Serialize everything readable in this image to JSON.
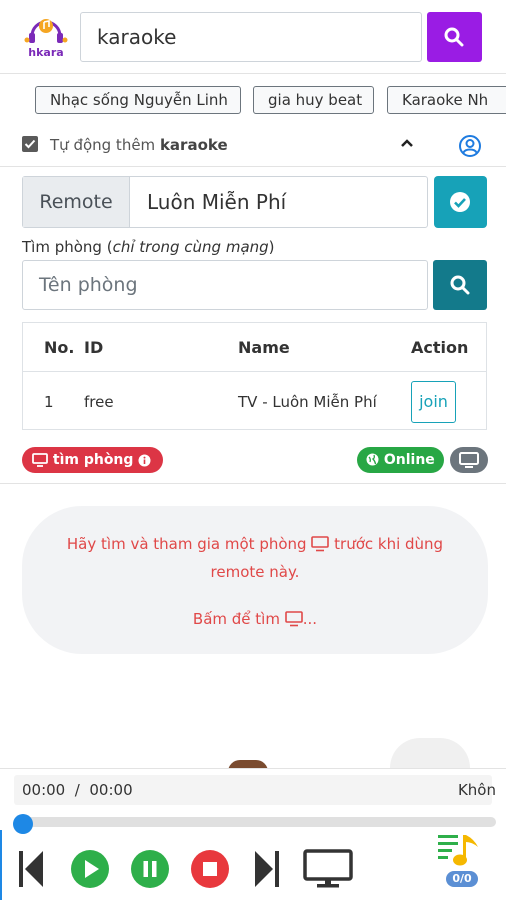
{
  "header": {
    "logo_text": "hkara",
    "search_value": "karaoke"
  },
  "suggestions": [
    "Nhạc sống Nguyễn Linh",
    "gia huy beat",
    "Karaoke Nh"
  ],
  "auto_add": {
    "label_prefix": "Tự động thêm",
    "label_keyword": "karaoke",
    "checked": true
  },
  "remote": {
    "addon_label": "Remote",
    "value": "Luôn Miễn Phí"
  },
  "room_search": {
    "label_prefix": "Tìm phòng (",
    "label_italic": "chỉ trong cùng mạng",
    "label_suffix": ")",
    "placeholder": "Tên phòng"
  },
  "table": {
    "headers": [
      "No.",
      "ID",
      "Name",
      "Action"
    ],
    "rows": [
      {
        "no": "1",
        "id": "free",
        "name": "TV - Luôn Miễn Phí",
        "action": "join"
      }
    ]
  },
  "badges": {
    "find_room": "tìm phòng",
    "online": "Online"
  },
  "message": {
    "line1_before": "Hãy tìm và tham gia một phòng",
    "line1_after": "trước khi dùng",
    "line2": "remote này.",
    "link_text": "Bấm để tìm",
    "link_suffix": "..."
  },
  "player": {
    "current_time": "00:00",
    "separator": "/",
    "duration": "00:00",
    "status": "Khôn",
    "progress": 0,
    "playlist_count": "0/0"
  },
  "colors": {
    "brand_purple": "#9a1ce4",
    "teal": "#17a2b8",
    "danger": "#dc3545",
    "success": "#28a745",
    "player_green": "#2eaf4a",
    "player_red": "#e8383d",
    "message_red": "#e04848"
  }
}
